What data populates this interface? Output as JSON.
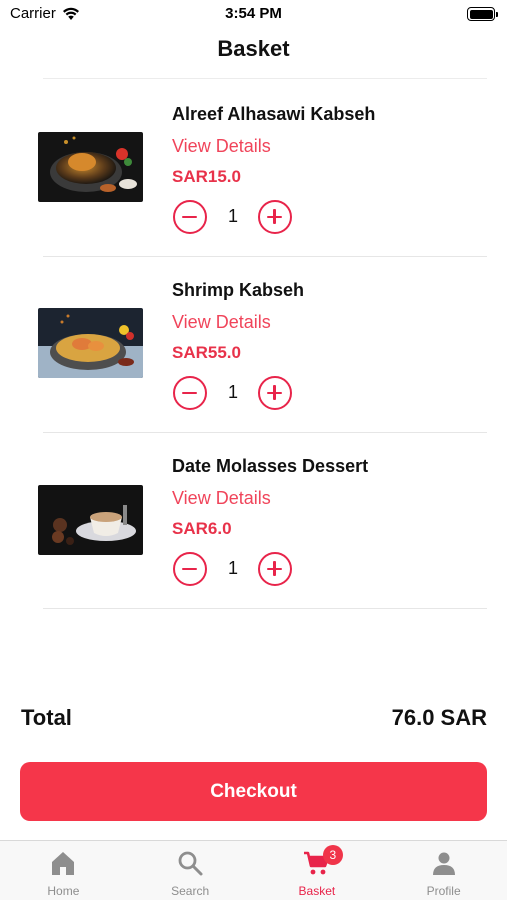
{
  "status_bar": {
    "carrier": "Carrier",
    "time": "3:54 PM",
    "icons": [
      "wifi-icon",
      "battery-icon"
    ]
  },
  "nav": {
    "title": "Basket"
  },
  "basket": {
    "items": [
      {
        "name": "Alreef Alhasawi Kabseh",
        "details_label": "View Details",
        "price": "SAR15.0",
        "quantity": "1"
      },
      {
        "name": "Shrimp Kabseh",
        "details_label": "View Details",
        "price": "SAR55.0",
        "quantity": "1"
      },
      {
        "name": "Date Molasses Dessert",
        "details_label": "View Details",
        "price": "SAR6.0",
        "quantity": "1"
      }
    ]
  },
  "total": {
    "label": "Total",
    "value": "76.0 SAR"
  },
  "checkout": {
    "label": "Checkout"
  },
  "tab_bar": {
    "tabs": [
      {
        "label": "Home",
        "icon": "home-icon",
        "active": false
      },
      {
        "label": "Search",
        "icon": "search-icon",
        "active": false
      },
      {
        "label": "Basket",
        "icon": "cart-icon",
        "active": true,
        "badge": "3"
      },
      {
        "label": "Profile",
        "icon": "person-icon",
        "active": false
      }
    ]
  },
  "colors": {
    "accent": "#f5364a",
    "price": "#e8324a",
    "link": "#f0445a",
    "tab_inactive": "#8e8e8e"
  }
}
